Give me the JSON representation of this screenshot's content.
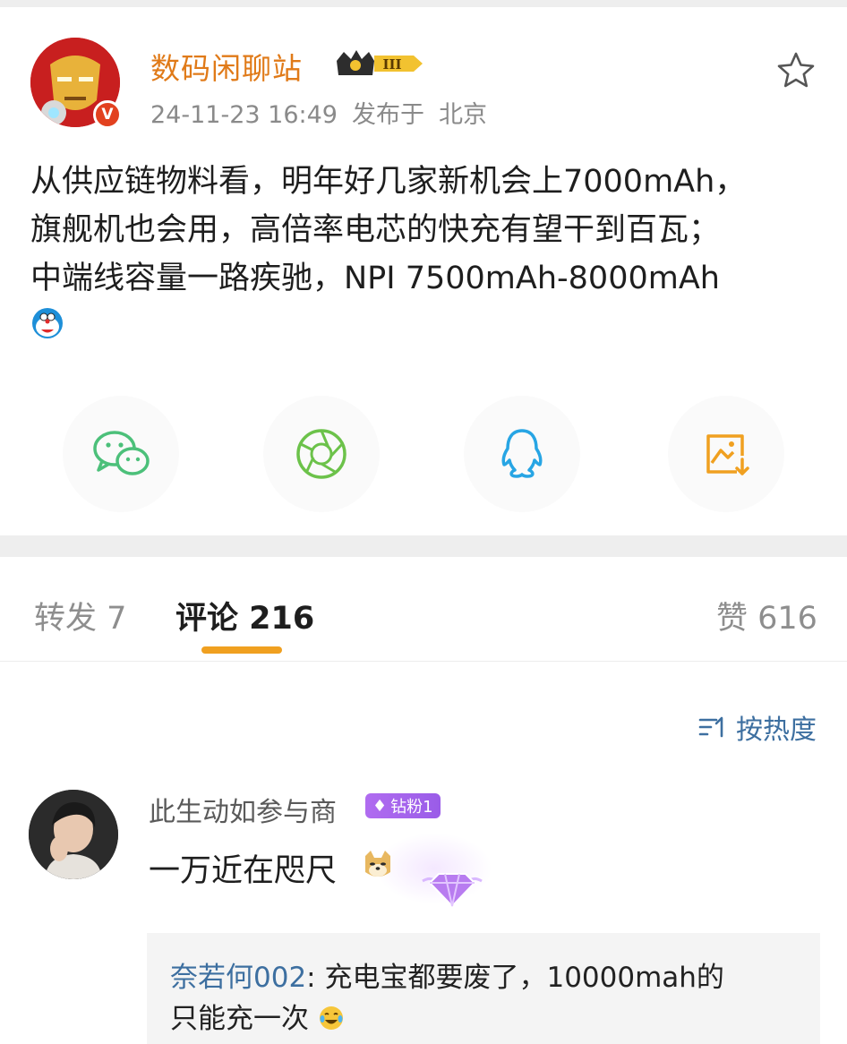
{
  "post": {
    "author": "数码闲聊站",
    "level_badge": "III",
    "timestamp": "24-11-23 16:49",
    "location_prefix": "发布于",
    "location": "北京",
    "text_lines": [
      "从供应链物料看，明年好几家新机会上7000mAh，",
      "旗舰机也会用，高倍率电芯的快充有望干到百瓦；",
      "中端线容量一路疾驰，NPI 7500mAh-8000mAh"
    ],
    "emoji": "doraemon-emoji"
  },
  "share": {
    "icons": [
      "wechat-icon",
      "moments-icon",
      "qq-icon",
      "save-image-icon"
    ],
    "colors": {
      "wechat": "#4cc07a",
      "moments": "#6cc24a",
      "qq": "#27a5e4",
      "save": "#f0a020"
    }
  },
  "tabs": {
    "repost": "转发 7",
    "comments": "评论 216",
    "likes": "赞 616"
  },
  "sort": {
    "label": "按热度"
  },
  "comment": {
    "username": "此生动如参与商",
    "fan_badge": "钻粉1",
    "text": "一万近在咫尺",
    "reply": {
      "user": "奈若何002",
      "line1": ": 充电宝都要废了，10000mah的",
      "line2": "只能充一次"
    }
  },
  "colors": {
    "author": "#e07a18",
    "link": "#3d6fa0",
    "tab_indicator": "#f0a020"
  }
}
